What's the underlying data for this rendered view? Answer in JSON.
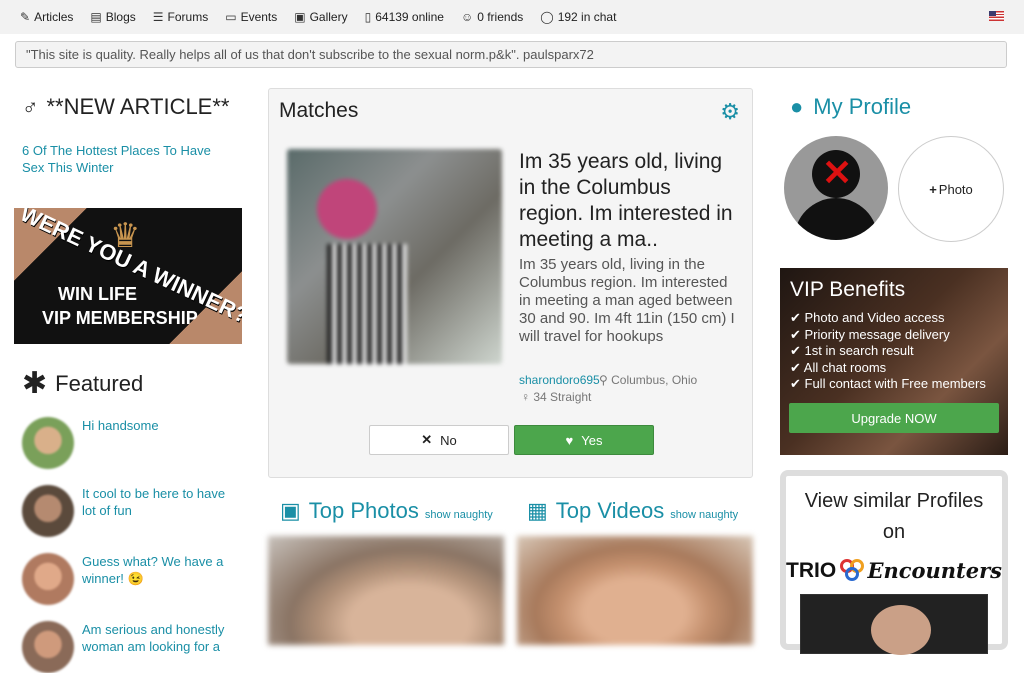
{
  "nav": {
    "items": [
      {
        "label": "Articles",
        "icon": "pencil-icon"
      },
      {
        "label": "Blogs",
        "icon": "book-icon"
      },
      {
        "label": "Forums",
        "icon": "list-icon"
      },
      {
        "label": "Events",
        "icon": "calendar-icon"
      },
      {
        "label": "Gallery",
        "icon": "images-icon"
      },
      {
        "label": "64139 online",
        "icon": "phone-icon"
      },
      {
        "label": "0 friends",
        "icon": "users-icon"
      },
      {
        "label": "192 in chat",
        "icon": "chat-icon"
      }
    ],
    "flag": "us-flag-icon"
  },
  "quote": "\"This site is quality. Really helps all of us that don't subscribe to the sexual norm.p&k\". paulsparx72",
  "left": {
    "new_article_title": "**NEW ARTICLE**",
    "article_link": "6 Of The Hottest Places To Have Sex This Winter",
    "banner": {
      "line1": "WERE YOU A WINNER?",
      "line2": "WIN LIFE",
      "line3": "VIP MEMBERSHIP"
    },
    "featured_title": "Featured",
    "featured": [
      {
        "text": "Hi handsome"
      },
      {
        "text": "It cool to be here to have lot of fun"
      },
      {
        "text": "Guess what? We have a winner! 😉"
      },
      {
        "text": "Am serious and honestly woman am looking for a"
      }
    ]
  },
  "matches": {
    "title": "Matches",
    "headline": "Im 35 years old, living in the Columbus region. Im interested in meeting a ma..",
    "description": "Im 35 years old, living in the Columbus region. Im interested in meeting a man aged between 30 and 90. Im 4ft 11in (150 cm) I will travel for hookups",
    "username": "sharondoro695",
    "location": "Columbus, Ohio",
    "age_orientation": "34 Straight",
    "no_label": "No",
    "yes_label": "Yes"
  },
  "top_photos": {
    "title": "Top Photos",
    "link": "show naughty"
  },
  "top_videos": {
    "title": "Top Videos",
    "link": "show naughty"
  },
  "right": {
    "my_profile": "My Profile",
    "add_photo": "Photo",
    "vip": {
      "title": "VIP Benefits",
      "benefits": [
        "Photo and Video access",
        "Priority message delivery",
        "1st in search result",
        "All chat rooms",
        "Full contact with Free members"
      ],
      "upgrade": "Upgrade NOW"
    },
    "similar": {
      "line1": "View similar Profiles",
      "line2": "on",
      "brand1": "TRIO",
      "brand2": "Encounters"
    }
  },
  "colors": {
    "accent": "#1a8fa6",
    "green": "#4ca64c"
  }
}
